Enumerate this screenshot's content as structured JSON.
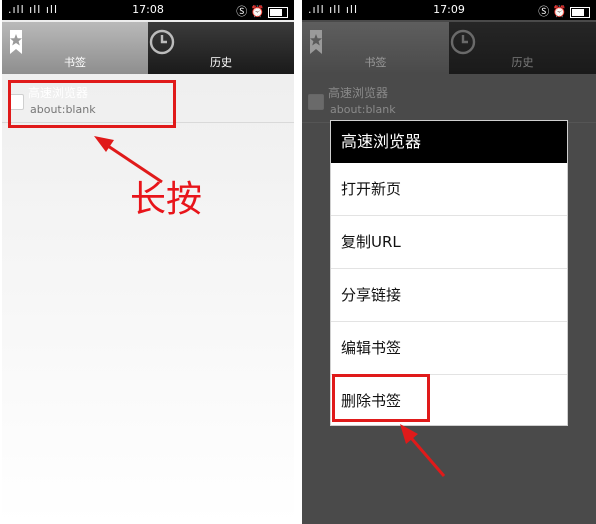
{
  "left_screen": {
    "status": {
      "signal_text": ".ıll ıll ıll",
      "time": "17:08",
      "right_icons": "Ⓢ ⏰"
    },
    "tabs": [
      {
        "label": "书签"
      },
      {
        "label": "历史"
      }
    ],
    "bookmark": {
      "title": "高速浏览器",
      "url": "about:blank"
    },
    "annotation": "长按"
  },
  "right_screen": {
    "status": {
      "signal_text": ".ıll ıll ıll",
      "time": "17:09",
      "right_icons": "Ⓢ ⏰"
    },
    "tabs": [
      {
        "label": "书签"
      },
      {
        "label": "历史"
      }
    ],
    "bookmark": {
      "title": "高速浏览器",
      "url": "about:blank"
    },
    "dialog": {
      "title": "高速浏览器",
      "items": [
        "打开新页",
        "复制URL",
        "分享链接",
        "编辑书签",
        "删除书签"
      ]
    }
  },
  "colors": {
    "annotation_red": "#e01a1a"
  }
}
